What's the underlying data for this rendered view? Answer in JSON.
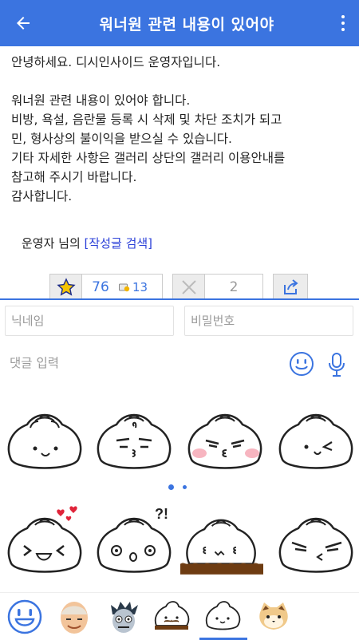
{
  "header": {
    "title": "워너원 관련 내용이 있어야"
  },
  "post": {
    "lines": [
      "안녕하세요. 디시인사이드 운영자입니다.",
      "",
      "워너원 관련 내용이 있어야 합니다.",
      "비방, 욕설, 음란물 등록 시 삭제 및 차단 조치가 되고",
      "민, 형사상의 불이익을 받으실 수 있습니다.",
      "기타 자세한 사항은 갤러리 상단의 갤러리 이용안내를",
      "참고해 주시기 바랍니다.",
      "감사합니다."
    ],
    "author_prefix": "운영자 님의 ",
    "author_link": "[작성글 검색]"
  },
  "votes": {
    "up_count": "76",
    "fixed_count": "13",
    "down_count": "2"
  },
  "comment": {
    "nickname_placeholder": "닉네임",
    "password_placeholder": "비밀번호",
    "input_placeholder": "댓글 입력"
  },
  "stickers": {
    "pager_pages": 2,
    "pager_active": 1
  },
  "colors": {
    "accent": "#3b74e0",
    "link": "#2a3fd8"
  }
}
